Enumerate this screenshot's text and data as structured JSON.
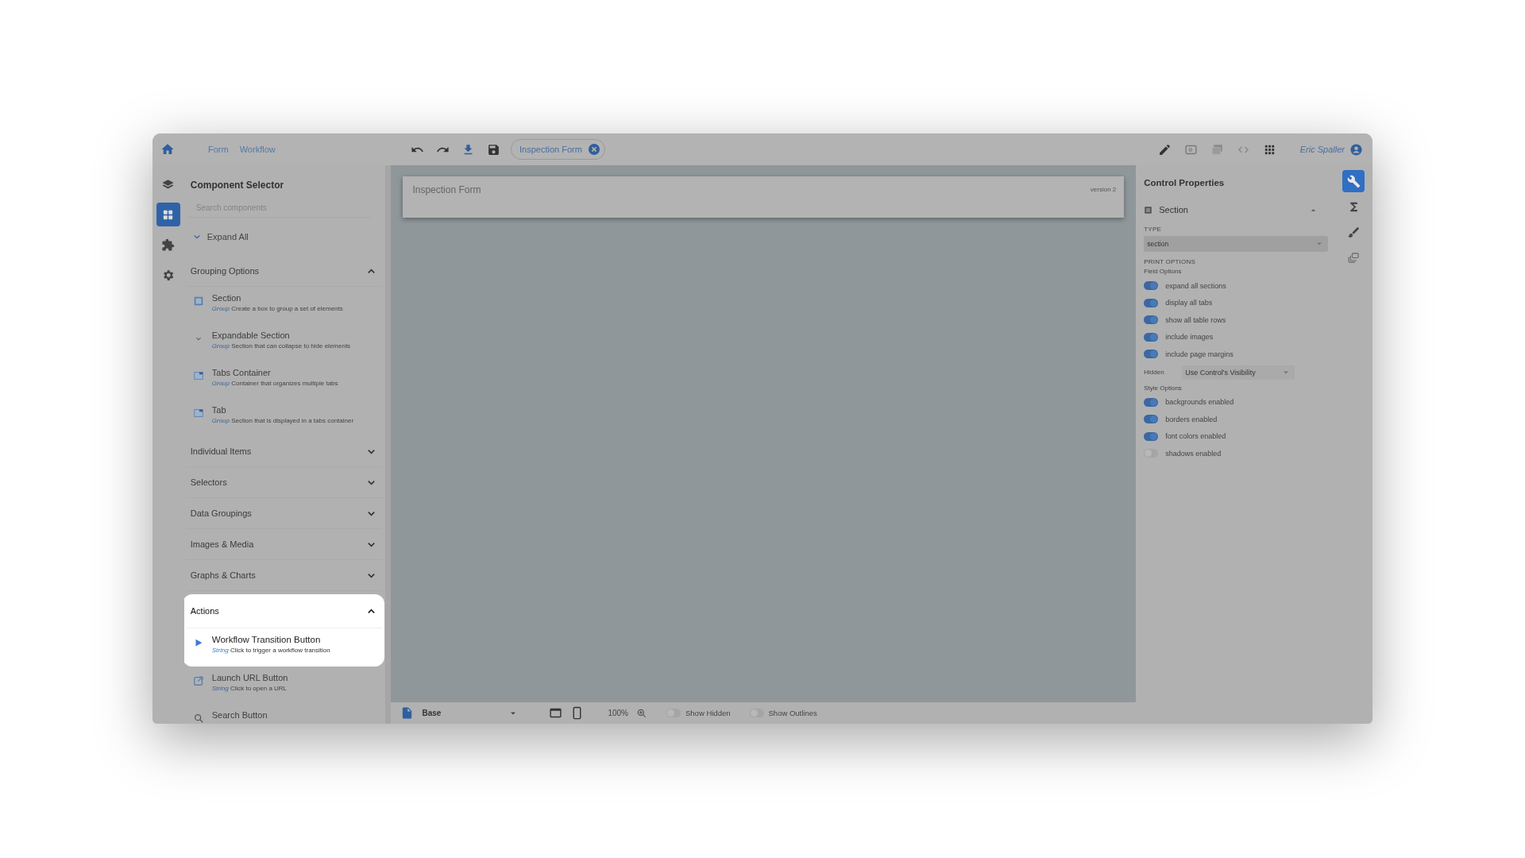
{
  "top_bar": {
    "breadcrumbs": [
      "Form",
      "Workflow"
    ],
    "open_tab": "Inspection Form",
    "user": "Eric Spaller"
  },
  "icon_rail": [
    {
      "selected": false
    },
    {
      "selected": true
    },
    {
      "selected": false
    },
    {
      "selected": false
    }
  ],
  "component_selector": {
    "title": "Component Selector",
    "search": {
      "placeholder": "Search components"
    },
    "expand_all": "Expand All",
    "groups": [
      {
        "label": "Grouping Options",
        "expanded": true,
        "highlighted": false,
        "items": [
          {
            "name": "Section",
            "tag": "Group",
            "description": "Create a box to group a set of elements",
            "highlighted": false
          },
          {
            "name": "Expandable Section",
            "tag": "Group",
            "description": "Section that can collapse to hide elements",
            "highlighted": false
          },
          {
            "name": "Tabs Container",
            "tag": "Group",
            "description": "Container that organizes multiple tabs",
            "highlighted": false
          },
          {
            "name": "Tab",
            "tag": "Group",
            "description": "Section that is displayed in a tabs container",
            "highlighted": false
          }
        ]
      },
      {
        "label": "Individual Items",
        "expanded": false,
        "highlighted": false
      },
      {
        "label": "Selectors",
        "expanded": false,
        "highlighted": false
      },
      {
        "label": "Data Groupings",
        "expanded": false,
        "highlighted": false
      },
      {
        "label": "Images & Media",
        "expanded": false,
        "highlighted": false
      },
      {
        "label": "Graphs & Charts",
        "expanded": false,
        "highlighted": false
      },
      {
        "label": "Actions",
        "expanded": true,
        "highlighted": true,
        "items": [
          {
            "name": "Workflow Transition Button",
            "tag": "String",
            "description": "Click to trigger a workflow transition",
            "highlighted": true
          },
          {
            "name": "Launch URL Button",
            "tag": "String",
            "description": "Click to open a URL",
            "highlighted": false
          },
          {
            "name": "Search Button",
            "highlighted": false
          }
        ]
      }
    ]
  },
  "canvas": {
    "form_title": "Inspection Form",
    "version": "version 2"
  },
  "bottom_bar": {
    "layer": "Base",
    "zoom": "100%",
    "toggles": [
      {
        "label": "Show Hidden",
        "on": false
      },
      {
        "label": "Show Outlines",
        "on": false
      }
    ]
  },
  "control_properties": {
    "title": "Control Properties",
    "section": "Section",
    "type_label": "TYPE",
    "type_value": "section",
    "print_heading": "PRINT OPTIONS",
    "field_options_label": "Field Options",
    "field_options": [
      {
        "label": "expand all sections",
        "on": true
      },
      {
        "label": "display all tabs",
        "on": true
      },
      {
        "label": "show all table rows",
        "on": true
      },
      {
        "label": "include images",
        "on": true
      },
      {
        "label": "include page margins",
        "on": true
      }
    ],
    "hidden": {
      "label": "Hidden",
      "value": "Use Control's Visibility"
    },
    "style_options_label": "Style Options",
    "style_options": [
      {
        "label": "backgrounds enabled",
        "on": true
      },
      {
        "label": "borders enabled",
        "on": true
      },
      {
        "label": "font colors enabled",
        "on": true
      },
      {
        "label": "shadows enabled",
        "on": false
      }
    ]
  },
  "right_rail": [
    {
      "selected": true
    },
    {
      "selected": false
    },
    {
      "selected": false
    },
    {
      "selected": false
    }
  ]
}
